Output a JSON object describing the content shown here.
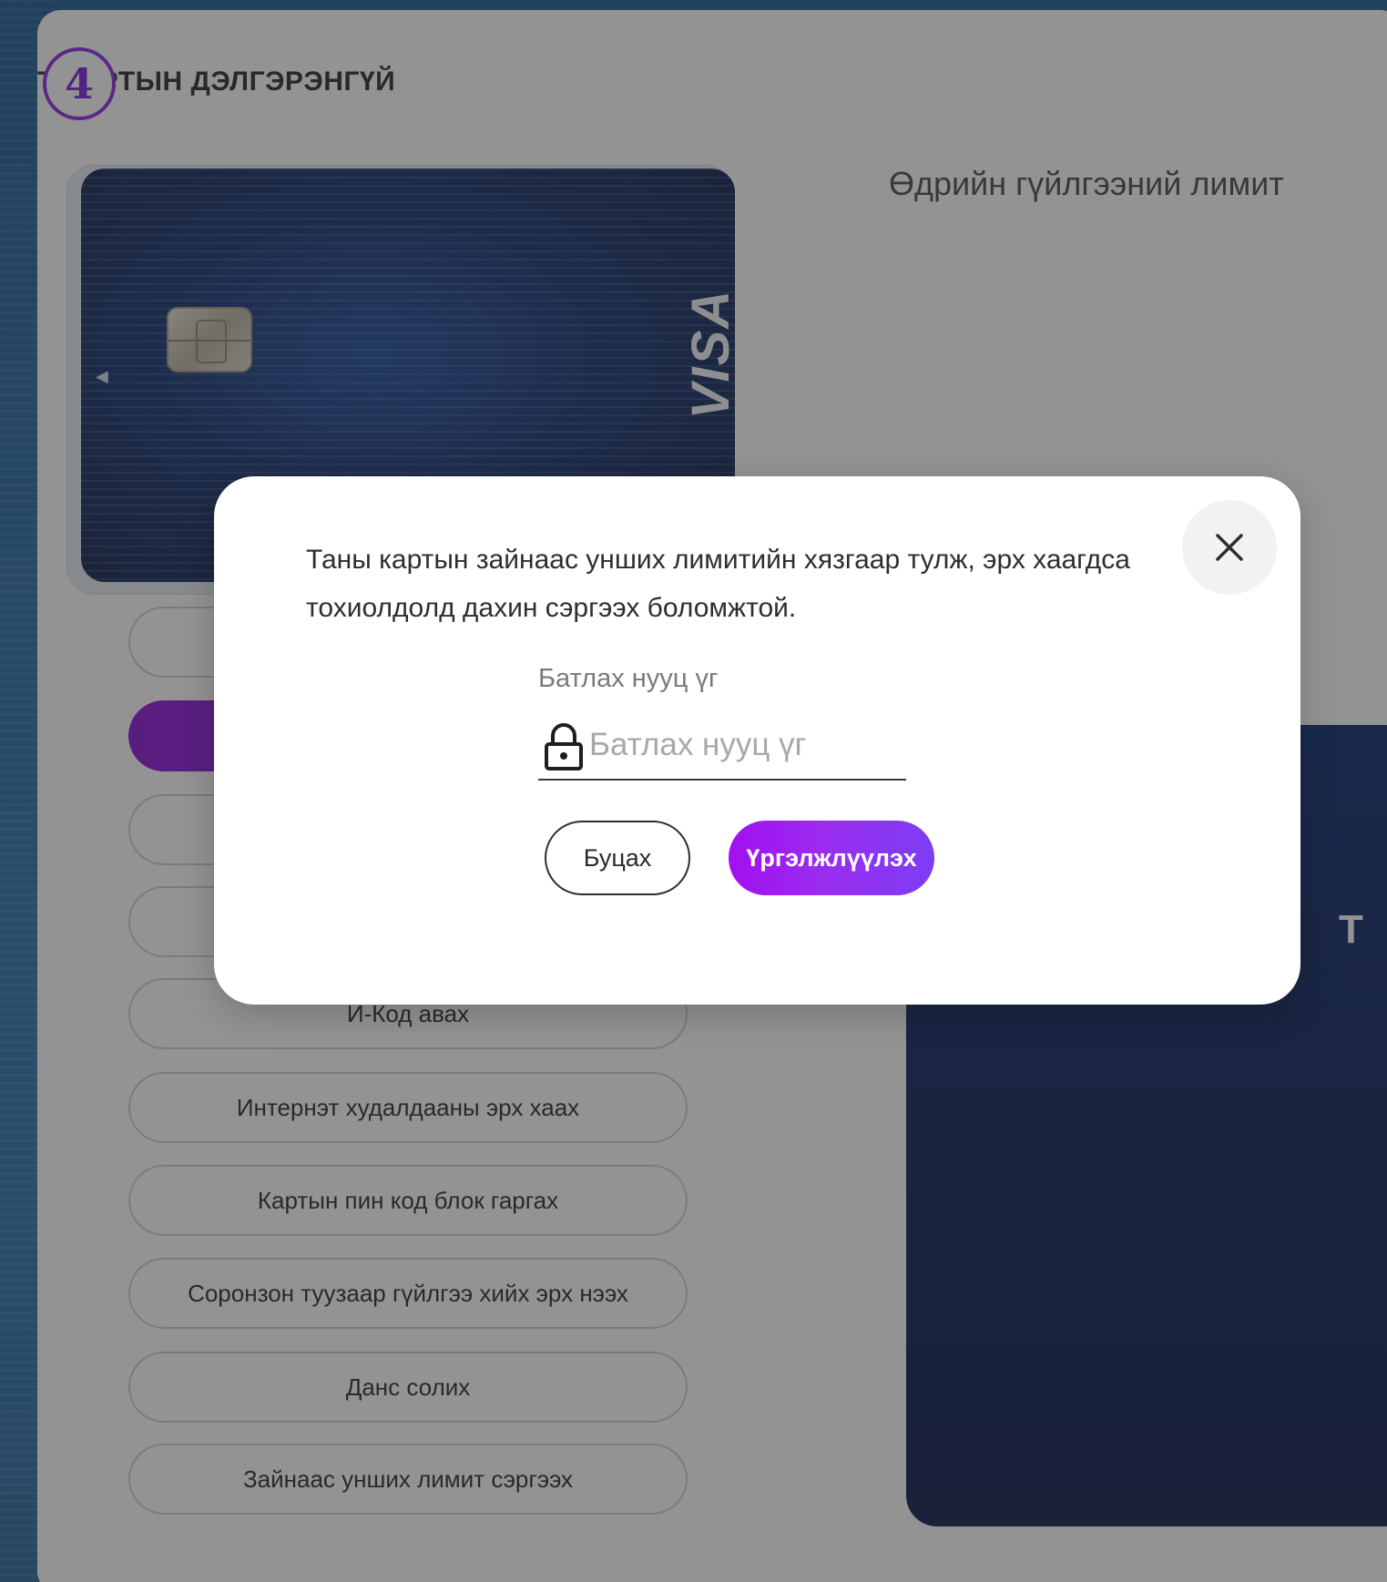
{
  "page": {
    "title": "Т КАРТЫН ДЭЛГЭРЭНГҮЙ",
    "step_number": "4"
  },
  "card": {
    "brand": "VISA"
  },
  "actions": [
    {
      "label": "",
      "active": false
    },
    {
      "label": "",
      "active": true
    },
    {
      "label": "",
      "active": false
    },
    {
      "label": "",
      "active": false
    },
    {
      "label": "И-Код авах",
      "active": false
    },
    {
      "label": "Интернэт худалдааны эрх хаах",
      "active": false
    },
    {
      "label": "Картын пин код блок гаргах",
      "active": false
    },
    {
      "label": "Соронзон туузаар гүйлгээ хийх эрх нээх",
      "active": false
    },
    {
      "label": "Данс солих",
      "active": false
    },
    {
      "label": "Зайнаас унших лимит сэргээх",
      "active": false
    }
  ],
  "right_panel": {
    "title": "Өдрийн гүйлгээний лимит",
    "promo_text": "Т"
  },
  "modal": {
    "message_line1": "Таны картын зайнаас унших лимитийн хязгаар тулж, эрх хаагдса",
    "message_line2": "тохиолдолд дахин сэргээх боломжтой.",
    "password_label": "Батлах нууц үг",
    "password_placeholder": "Батлах нууц үг",
    "password_value": "",
    "back_label": "Буцах",
    "continue_label": "Үргэлжлүүлэх"
  },
  "colors": {
    "accent": "#8a12d8",
    "overlay": "rgba(40,40,40,0.5)",
    "card_dark": "#14306e"
  }
}
